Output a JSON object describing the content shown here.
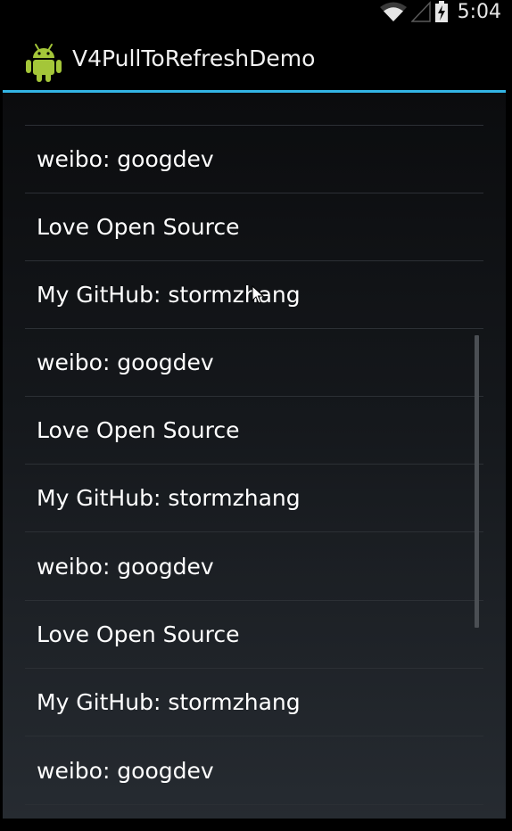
{
  "status_bar": {
    "time": "5:04",
    "icons": [
      "wifi-icon",
      "signal-icon",
      "battery-charging-icon"
    ]
  },
  "action_bar": {
    "app_icon": "android-icon",
    "title": "V4PullToRefreshDemo",
    "accent_color": "#33b5e5"
  },
  "list": {
    "items": [
      {
        "label": "weibo: googdev"
      },
      {
        "label": "Love Open Source"
      },
      {
        "label": "My GitHub: stormzhang"
      },
      {
        "label": "weibo: googdev"
      },
      {
        "label": "Love Open Source"
      },
      {
        "label": "My GitHub: stormzhang"
      },
      {
        "label": "weibo: googdev"
      },
      {
        "label": "Love Open Source"
      },
      {
        "label": "My GitHub: stormzhang"
      },
      {
        "label": "weibo: googdev"
      }
    ]
  }
}
